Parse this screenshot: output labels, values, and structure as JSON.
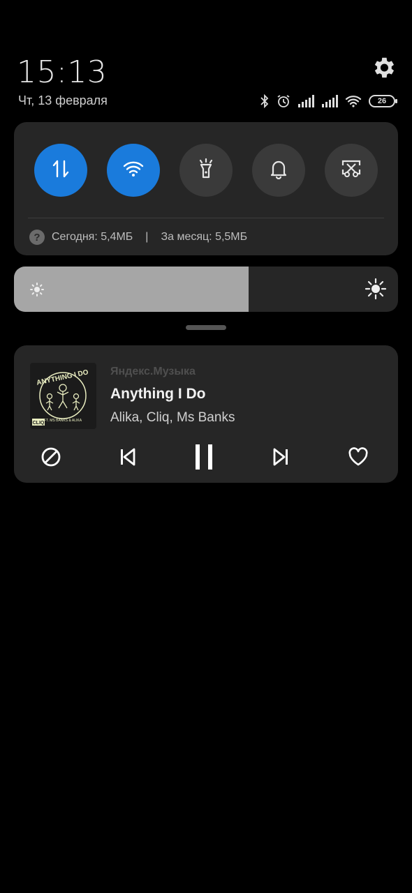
{
  "status_bar": {
    "time": "15:13",
    "date": "Чт, 13 февраля",
    "battery": "26",
    "icons": [
      "bluetooth-icon",
      "alarm-icon",
      "signal-icon",
      "signal-icon",
      "wifi-icon",
      "battery-icon"
    ]
  },
  "quick_settings": {
    "toggles": [
      {
        "name": "mobile-data",
        "icon": "data-arrows-icon",
        "active": true
      },
      {
        "name": "wifi",
        "icon": "wifi-icon",
        "active": true
      },
      {
        "name": "flashlight",
        "icon": "flashlight-icon",
        "active": false
      },
      {
        "name": "sound",
        "icon": "bell-icon",
        "active": false
      },
      {
        "name": "screenshot",
        "icon": "scissors-screenshot-icon",
        "active": false
      }
    ],
    "usage_today": "Сегодня: 5,4МБ",
    "usage_separator": "|",
    "usage_month": "За месяц: 5,5МБ",
    "help_icon_text": "?"
  },
  "brightness": {
    "level_percent": 61
  },
  "media": {
    "app": "Яндекс.Музыка",
    "title": "Anything I Do",
    "artist": "Alika, Cliq, Ms Banks",
    "art_text": "ANYTHING I DO",
    "art_sub": "FT. MS BANKS & ALIKA",
    "art_logo": "CLIQ",
    "controls": [
      "dislike-icon",
      "previous-icon",
      "pause-icon",
      "next-icon",
      "heart-icon"
    ]
  },
  "colors": {
    "accent": "#1a7bdc",
    "panel": "#262626",
    "tile_off": "#3a3a3a",
    "art_line": "#e9edc0"
  }
}
